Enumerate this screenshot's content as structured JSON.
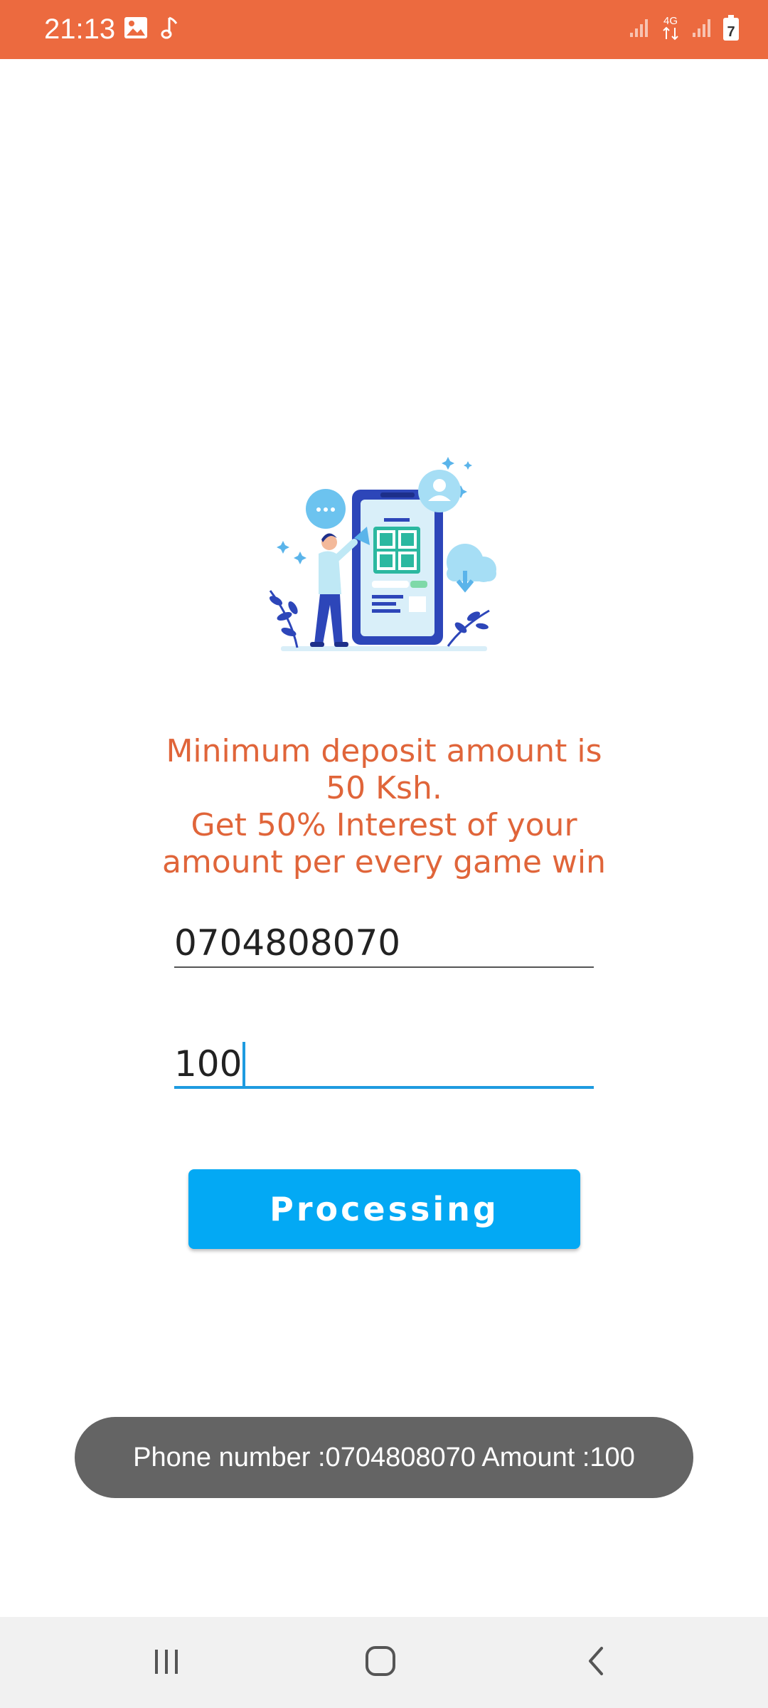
{
  "status_bar": {
    "time": "21:13",
    "icons": [
      "gallery-icon",
      "music-note-icon",
      "signal-icon",
      "4g-data-icon",
      "signal-icon",
      "battery-icon"
    ],
    "network_label": "4G",
    "battery_level": "7",
    "background": "#ec6a3f"
  },
  "main": {
    "illustration": "qr-deposit-illustration",
    "info_text": {
      "line1": "Minimum deposit amount is",
      "line2": "50 Ksh.",
      "line3": "Get 50% Interest of your",
      "line4": "amount per every game win"
    },
    "phone_input": {
      "value": "0704808070"
    },
    "amount_input": {
      "value": "100",
      "focused": true
    },
    "process_button": {
      "label": "Processing",
      "color": "#03a9f4"
    }
  },
  "toast": {
    "message": "Phone number :0704808070 Amount :100"
  },
  "nav_bar": {
    "icons": [
      "recents-icon",
      "home-icon",
      "back-icon"
    ]
  },
  "colors": {
    "accent": "#ec6a3f",
    "info_text": "#e0653a",
    "focus_line": "#1e9be0"
  }
}
